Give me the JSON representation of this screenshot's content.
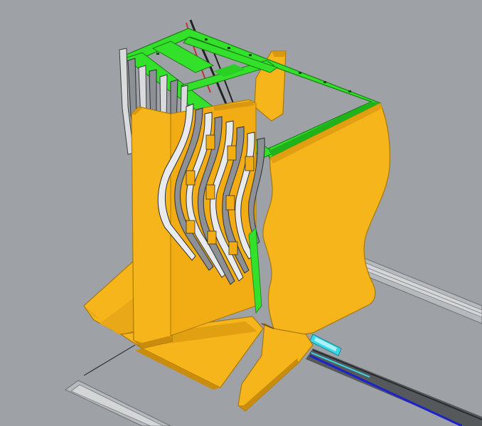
{
  "viewport": {
    "background": "#9ea1a6",
    "description_colors": {
      "part_yellow": "#f6b51b",
      "part_yellow_shade": "#e0a012",
      "part_yellow_dark": "#c98c0c",
      "frame_green": "#33e02a",
      "frame_green_dark": "#1fb31a",
      "fin_gray": "#8d9094",
      "fin_light": "#e8eaec",
      "rail_gray": "#b7babd",
      "cyan_part": "#39d8e6",
      "blue_cable": "#1a22c8"
    }
  }
}
